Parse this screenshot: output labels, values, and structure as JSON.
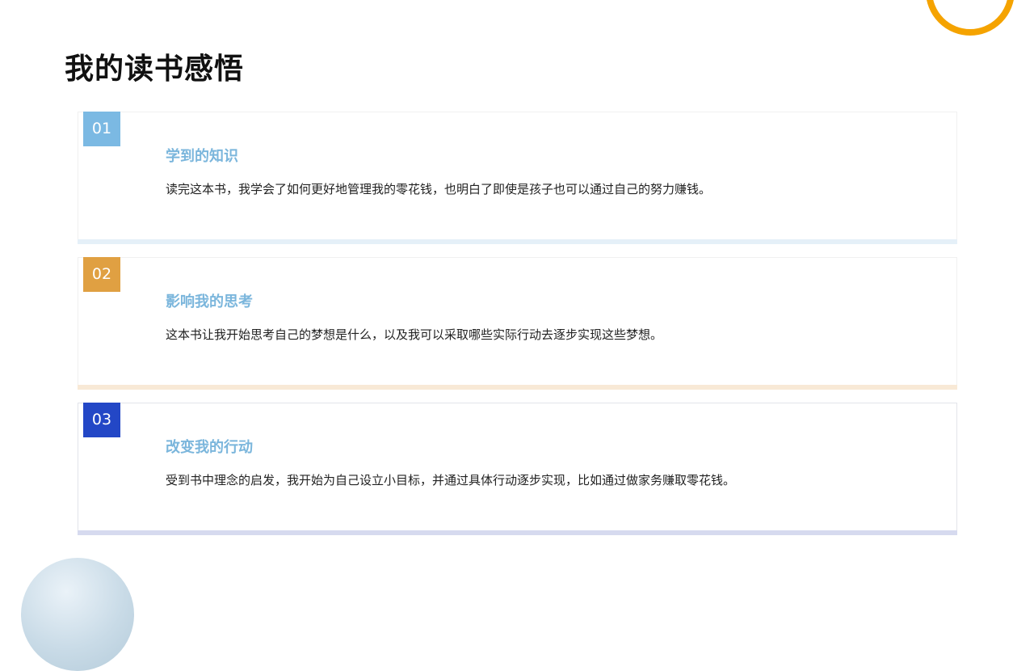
{
  "page": {
    "title": "我的读书感悟"
  },
  "colors": {
    "accent_ring": "#F5A300",
    "card1_badge": "#7BB9E3",
    "card2_badge": "#E0A042",
    "card3_badge": "#2347C6",
    "card_title": "#7BB6DC"
  },
  "cards": [
    {
      "number": "01",
      "title": "学到的知识",
      "text": "读完这本书，我学会了如何更好地管理我的零花钱，也明白了即使是孩子也可以通过自己的努力赚钱。"
    },
    {
      "number": "02",
      "title": "影响我的思考",
      "text": "这本书让我开始思考自己的梦想是什么，以及我可以采取哪些实际行动去逐步实现这些梦想。"
    },
    {
      "number": "03",
      "title": "改变我的行动",
      "text": "受到书中理念的启发，我开始为自己设立小目标，并通过具体行动逐步实现，比如通过做家务赚取零花钱。"
    }
  ]
}
